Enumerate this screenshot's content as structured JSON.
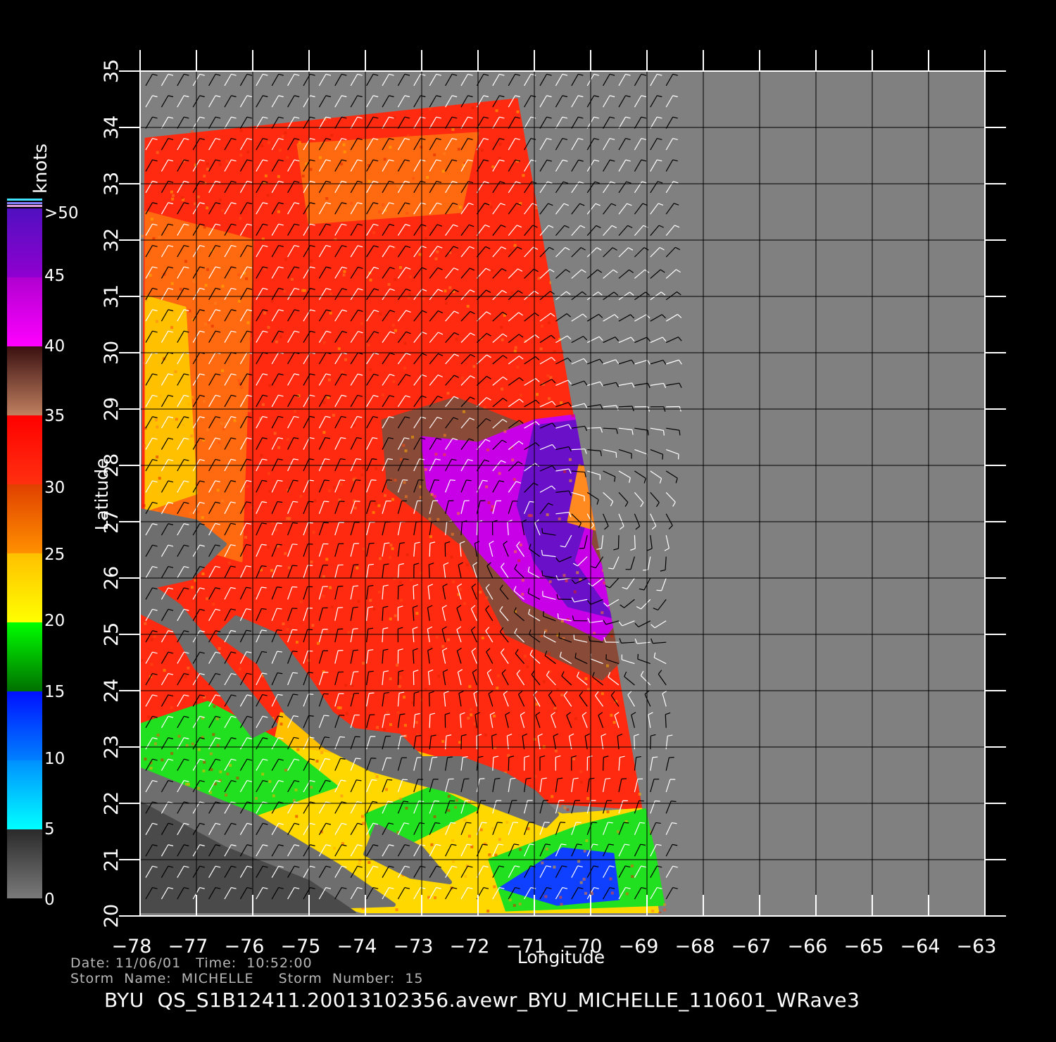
{
  "chart_data": {
    "type": "heatmap",
    "title": "BYU  QS_S1B12411.20013102356.avewr_BYU_MICHELLE_110601_WRave3",
    "xlabel": "Longitude",
    "ylabel": "Latitude",
    "xlim": [
      -78,
      -63
    ],
    "ylim": [
      20,
      35
    ],
    "x_ticks": [
      "-78",
      "-77",
      "-76",
      "-75",
      "-74",
      "-73",
      "-72",
      "-71",
      "-70",
      "-69",
      "-68",
      "-67",
      "-66",
      "-65",
      "-64",
      "-63"
    ],
    "y_ticks": [
      "20",
      "21",
      "22",
      "23",
      "24",
      "25",
      "26",
      "27",
      "28",
      "29",
      "30",
      "31",
      "32",
      "33",
      "34",
      "35"
    ],
    "grid": true,
    "colorbar": {
      "unit": "knots",
      "labels": [
        "0",
        "5",
        "10",
        "15",
        "20",
        "25",
        "30",
        "35",
        "40",
        "45",
        ">50"
      ],
      "bands": [
        {
          "from": 0,
          "to": 5,
          "color": "#7a7a7a",
          "color_to": "#2a2a2a"
        },
        {
          "from": 5,
          "to": 10,
          "color": "#00ffff",
          "color_to": "#0090ff"
        },
        {
          "from": 10,
          "to": 15,
          "color": "#0080ff",
          "color_to": "#0010ff"
        },
        {
          "from": 15,
          "to": 20,
          "color": "#007000",
          "color_to": "#00ff00"
        },
        {
          "from": 20,
          "to": 25,
          "color": "#ffff00",
          "color_to": "#ffc000"
        },
        {
          "from": 25,
          "to": 30,
          "color": "#ff9000",
          "color_to": "#e04000"
        },
        {
          "from": 30,
          "to": 35,
          "color": "#ff3010",
          "color_to": "#ff0000"
        },
        {
          "from": 35,
          "to": 40,
          "color": "#c08060",
          "color_to": "#3a1010"
        },
        {
          "from": 40,
          "to": 45,
          "color": "#ff00ff",
          "color_to": "#b000d0"
        },
        {
          "from": 45,
          "to": 50,
          "color": "#9000d0",
          "color_to": "#5010c0"
        }
      ]
    },
    "swath_outline_lonlat": [
      [
        -78,
        33.85
      ],
      [
        -71.3,
        34.55
      ],
      [
        -69.0,
        21.8
      ],
      [
        -68.6,
        20.05
      ],
      [
        -78,
        20.05
      ]
    ],
    "wind_regions": [
      {
        "speed_knots": 31,
        "color": "#ff2a10",
        "polygon": [
          [
            -77.9,
            33.8
          ],
          [
            -71.3,
            34.5
          ],
          [
            -69.1,
            21.9
          ],
          [
            -78,
            22.5
          ]
        ]
      },
      {
        "speed_knots": 28,
        "color": "#ff6a10",
        "polygon": [
          [
            -77.9,
            32.5
          ],
          [
            -76.0,
            32.0
          ],
          [
            -76.2,
            26.3
          ],
          [
            -77.9,
            26.8
          ]
        ]
      },
      {
        "speed_knots": 28,
        "color": "#ff6a10",
        "polygon": [
          [
            -75.2,
            33.7
          ],
          [
            -72.0,
            33.9
          ],
          [
            -72.3,
            32.5
          ],
          [
            -75.0,
            32.3
          ]
        ]
      },
      {
        "speed_knots": 24,
        "color": "#ffc000",
        "polygon": [
          [
            -77.9,
            31.0
          ],
          [
            -77.2,
            30.8
          ],
          [
            -77.0,
            27.5
          ],
          [
            -77.9,
            27.2
          ]
        ]
      },
      {
        "speed_knots": 24,
        "color": "#ffc000",
        "polygon": [
          [
            -75.5,
            23.6
          ],
          [
            -72.0,
            22.6
          ],
          [
            -71.0,
            21.5
          ],
          [
            -75.8,
            22.2
          ]
        ]
      },
      {
        "speed_knots": 22,
        "color": "#ffd800",
        "polygon": [
          [
            -78,
            22.3
          ],
          [
            -76.5,
            23.2
          ],
          [
            -73.0,
            22.6
          ],
          [
            -70.5,
            21.8
          ],
          [
            -69.1,
            21.9
          ],
          [
            -68.8,
            20.05
          ],
          [
            -74.0,
            20.05
          ],
          [
            -78,
            21.2
          ]
        ]
      },
      {
        "speed_knots": 18,
        "color": "#20e020",
        "polygon": [
          [
            -78,
            23.4
          ],
          [
            -76.8,
            23.8
          ],
          [
            -75.5,
            23.1
          ],
          [
            -74.5,
            22.3
          ],
          [
            -76.5,
            21.6
          ],
          [
            -78,
            22.2
          ]
        ]
      },
      {
        "speed_knots": 18,
        "color": "#20e020",
        "polygon": [
          [
            -74.0,
            21.8
          ],
          [
            -72.8,
            22.3
          ],
          [
            -72.0,
            21.9
          ],
          [
            -73.8,
            21.0
          ]
        ]
      },
      {
        "speed_knots": 18,
        "color": "#20e020",
        "polygon": [
          [
            -71.8,
            21.0
          ],
          [
            -70.2,
            21.6
          ],
          [
            -69.0,
            21.9
          ],
          [
            -68.7,
            20.2
          ],
          [
            -71.5,
            20.1
          ]
        ]
      },
      {
        "speed_knots": 12,
        "color": "#1040ff",
        "polygon": [
          [
            -71.6,
            20.5
          ],
          [
            -70.5,
            21.2
          ],
          [
            -69.6,
            21.1
          ],
          [
            -69.5,
            20.3
          ],
          [
            -70.6,
            20.2
          ]
        ]
      },
      {
        "speed_knots": 37,
        "color": "#8a4a38",
        "polygon": [
          [
            -73.7,
            28.8
          ],
          [
            -72.4,
            29.2
          ],
          [
            -70.9,
            28.6
          ],
          [
            -69.7,
            26.6
          ],
          [
            -69.2,
            24.8
          ],
          [
            -69.8,
            24.2
          ],
          [
            -71.5,
            25.0
          ],
          [
            -72.3,
            26.6
          ],
          [
            -73.6,
            27.6
          ]
        ]
      },
      {
        "speed_knots": 42,
        "color": "#c800e8",
        "polygon": [
          [
            -73.0,
            28.5
          ],
          [
            -72.0,
            28.4
          ],
          [
            -71.0,
            28.8
          ],
          [
            -70.2,
            28.9
          ],
          [
            -69.9,
            27.8
          ],
          [
            -70.0,
            26.6
          ],
          [
            -69.4,
            25.4
          ],
          [
            -69.8,
            24.9
          ],
          [
            -71.2,
            25.6
          ],
          [
            -72.1,
            26.6
          ],
          [
            -72.9,
            27.6
          ]
        ]
      },
      {
        "speed_knots": 48,
        "color": "#6a10c8",
        "polygon": [
          [
            -71.0,
            28.7
          ],
          [
            -70.2,
            28.8
          ],
          [
            -70.0,
            27.3
          ],
          [
            -70.3,
            26.3
          ],
          [
            -69.6,
            25.3
          ],
          [
            -70.4,
            25.5
          ],
          [
            -71.0,
            26.3
          ],
          [
            -71.3,
            27.3
          ]
        ]
      },
      {
        "speed_knots": 27,
        "color": "#ff8a20",
        "polygon": [
          [
            -70.2,
            28.0
          ],
          [
            -69.6,
            27.8
          ],
          [
            -69.7,
            26.8
          ],
          [
            -70.4,
            27.0
          ]
        ]
      }
    ],
    "land_no_data": [
      {
        "color": "#6e6e6e",
        "polygon": [
          [
            -78,
            27.2
          ],
          [
            -77.0,
            27.0
          ],
          [
            -76.5,
            26.6
          ],
          [
            -77.1,
            26.0
          ],
          [
            -78,
            25.8
          ]
        ]
      },
      {
        "color": "#6e6e6e",
        "polygon": [
          [
            -78,
            25.4
          ],
          [
            -77.4,
            25.1
          ],
          [
            -77.0,
            24.4
          ],
          [
            -76.6,
            24.0
          ],
          [
            -76.0,
            23.2
          ],
          [
            -75.6,
            23.4
          ],
          [
            -76.5,
            24.5
          ],
          [
            -77.3,
            25.5
          ],
          [
            -78,
            26.0
          ]
        ]
      },
      {
        "color": "#6e6e6e",
        "polygon": [
          [
            -76.3,
            25.3
          ],
          [
            -75.6,
            25.0
          ],
          [
            -75.0,
            24.2
          ],
          [
            -74.6,
            23.6
          ],
          [
            -74.2,
            23.3
          ],
          [
            -73.4,
            23.2
          ],
          [
            -73.0,
            22.8
          ],
          [
            -72.3,
            22.8
          ],
          [
            -71.5,
            22.5
          ],
          [
            -71.0,
            22.2
          ],
          [
            -70.6,
            21.8
          ],
          [
            -70.8,
            21.6
          ],
          [
            -71.6,
            21.9
          ],
          [
            -72.4,
            22.2
          ],
          [
            -73.2,
            22.4
          ],
          [
            -73.9,
            22.6
          ],
          [
            -74.7,
            23.0
          ],
          [
            -75.4,
            23.6
          ],
          [
            -75.9,
            24.5
          ],
          [
            -76.6,
            25.0
          ]
        ]
      },
      {
        "color": "#6e6e6e",
        "polygon": [
          [
            -73.8,
            21.6
          ],
          [
            -73.0,
            21.2
          ],
          [
            -72.5,
            20.6
          ],
          [
            -73.2,
            20.7
          ],
          [
            -74.0,
            21.1
          ]
        ]
      },
      {
        "color": "#6e6e6e",
        "polygon": [
          [
            -78,
            22.6
          ],
          [
            -76.0,
            21.8
          ],
          [
            -74.5,
            20.9
          ],
          [
            -73.5,
            20.2
          ],
          [
            -78,
            20.05
          ]
        ]
      },
      {
        "color": "#4a4a4a",
        "polygon": [
          [
            -78,
            22.0
          ],
          [
            -76.5,
            21.2
          ],
          [
            -75.0,
            20.6
          ],
          [
            -74.2,
            20.05
          ],
          [
            -78,
            20.05
          ]
        ]
      }
    ],
    "wind_field": {
      "storm_center_lon": -70.6,
      "storm_center_lat": 26.9,
      "ambient_dir_deg": 30
    }
  }
}
